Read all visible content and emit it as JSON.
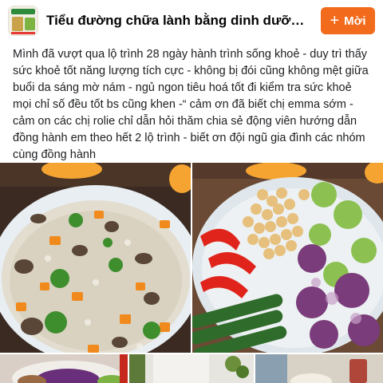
{
  "header": {
    "group_title": "Tiểu đường chữa lành bằng dinh dưỡng và ...",
    "join_label": "Mời",
    "join_icon": "plus-icon",
    "accent_color": "#f26a1b"
  },
  "post": {
    "text": "Mình đã vượt qua lộ trình 28 ngày hành trình sống khoẻ - duy trì thấy sức khoẻ tốt năng lượng tích cực - không bị đói cũng không mệt giữa buổi da sáng mờ nám  - ngủ ngon tiêu hoá tốt đi kiểm tra sức khoẻ mọi chỉ số đều tốt bs cũng khen -“ cảm ơn đã biết chị emma sớm - cảm on các chị rolie chỉ dẫn hỏi thăm chia sẻ động viên hướng dẫn đồng hành em theo hết 2 lộ trình - biết ơn đội ngũ gia đình các nhóm cùng đồng hành"
  },
  "photos": [
    {
      "name": "porridge-photo"
    },
    {
      "name": "salad-photo"
    },
    {
      "name": "purple-cabbage-photo"
    },
    {
      "name": "kitchen-photo"
    },
    {
      "name": "drink-photo"
    }
  ]
}
